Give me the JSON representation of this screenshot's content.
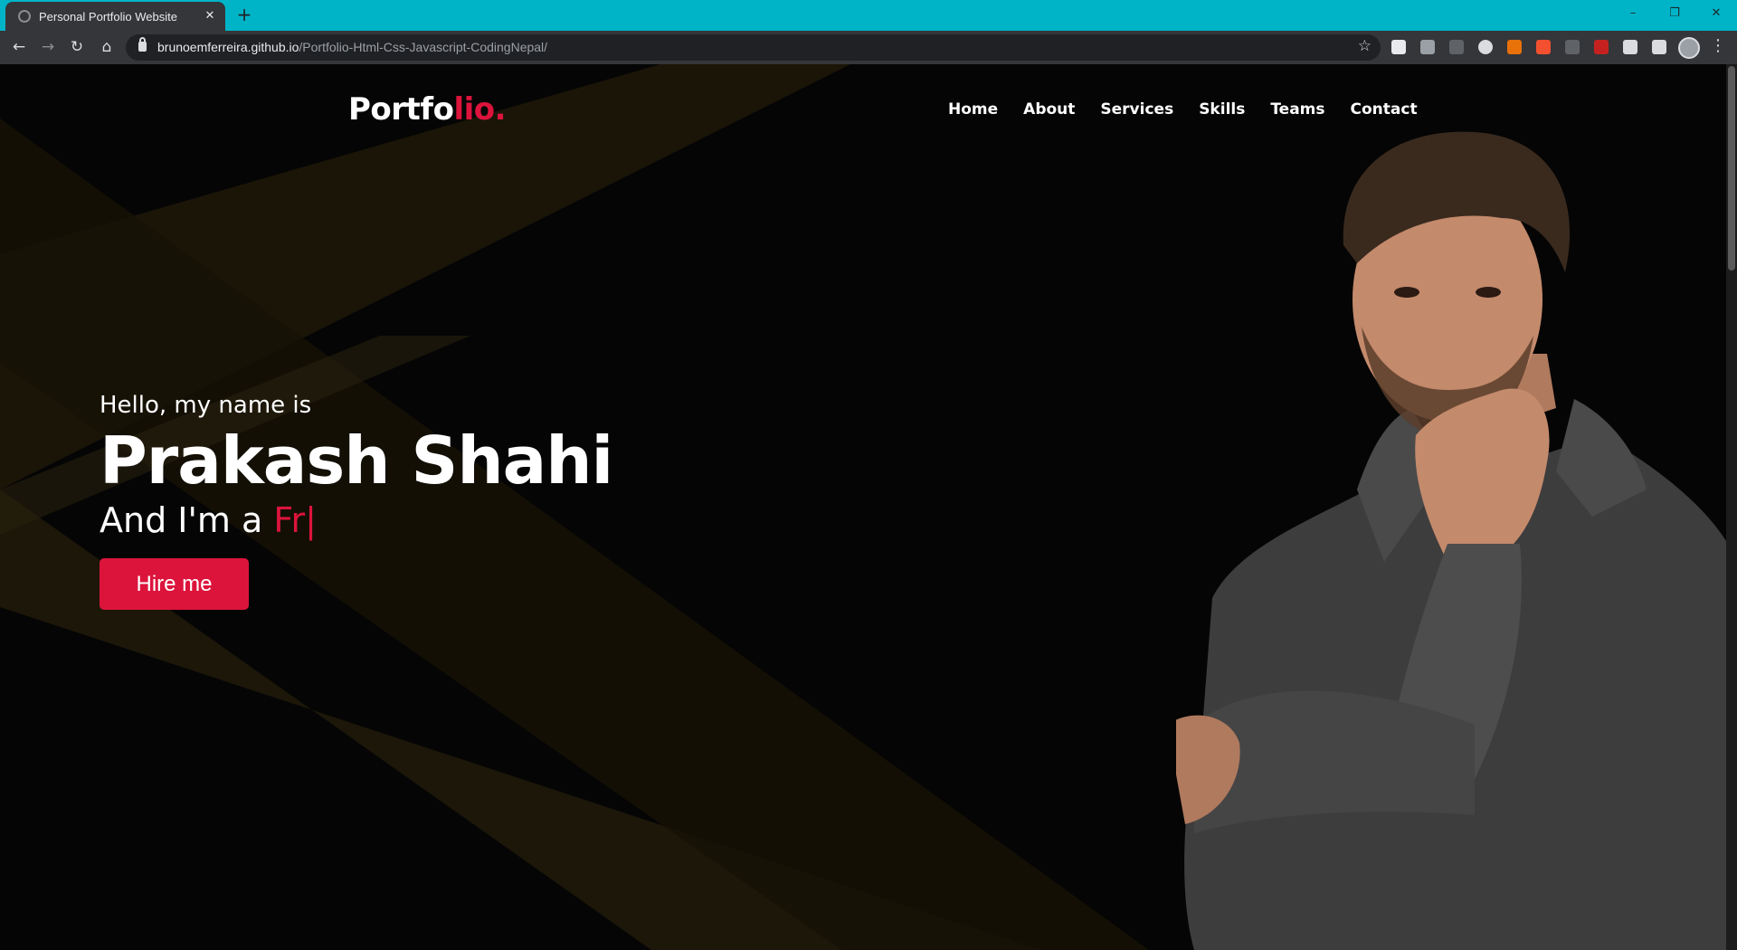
{
  "browser": {
    "tab_title": "Personal Portfolio Website",
    "new_tab": "+",
    "close_tab": "✕",
    "url_host": "brunoemferreira.github.io",
    "url_path": "/Portfolio-Html-Css-Javascript-CodingNepal/",
    "window_controls": {
      "minimize": "–",
      "restore": "❐",
      "close": "✕"
    },
    "nav_icons": {
      "back": "←",
      "forward": "→",
      "reload": "↻",
      "home": "⌂",
      "star": "☆",
      "menu": "⋮"
    }
  },
  "navbar": {
    "logo_main": "Portfo",
    "logo_accent": "lio.",
    "menu": [
      "Home",
      "About",
      "Services",
      "Skills",
      "Teams",
      "Contact"
    ]
  },
  "hero": {
    "greeting": "Hello, my name is",
    "name": "Prakash Shahi",
    "role_prefix": "And I'm a ",
    "role_typed": "Fr|",
    "button": "Hire me"
  },
  "colors": {
    "accent": "#dc143c",
    "background": "#050505",
    "tab_strip": "#00b4c8",
    "browser_chrome": "#35363a"
  }
}
